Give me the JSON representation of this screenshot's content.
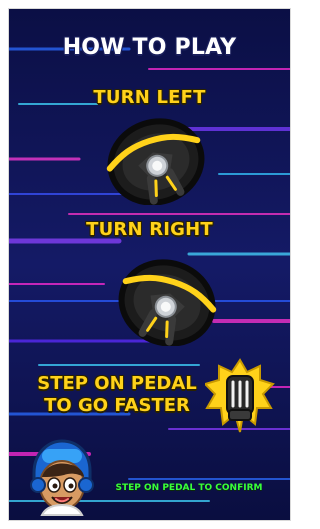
{
  "screen": {
    "title": "HOW TO PLAY",
    "turn_left_label": "TURN LEFT",
    "turn_right_label": "TURN RIGHT",
    "pedal_line1": "STEP ON PEDAL",
    "pedal_line2": "TO GO FASTER",
    "confirm_label": "STEP ON PEDAL TO CONFIRM"
  },
  "icons": {
    "left_wheel": "steering-wheel-icon",
    "right_wheel": "steering-wheel-icon",
    "pedal": "pedal-icon",
    "character": "character-avatar"
  },
  "colors": {
    "background": "#0a0f4a",
    "title": "#ffffff",
    "heading": "#ffd21a",
    "confirm": "#39ff3a"
  }
}
